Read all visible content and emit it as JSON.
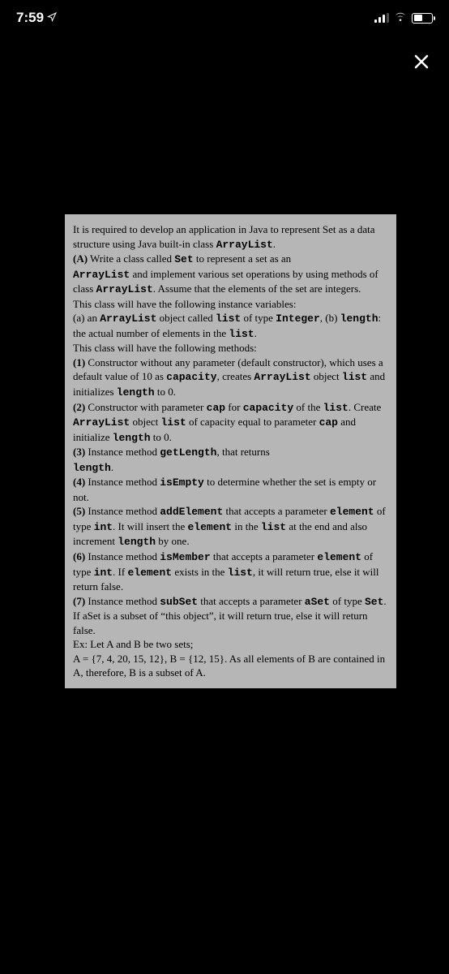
{
  "statusBar": {
    "time": "7:59"
  },
  "doc": {
    "intro1": "It is required to develop an application in Java to represent Set as a data structure using Java built-in class ",
    "intro_mono": "ArrayList",
    "intro_end": ".",
    "sectionA_prefix": "(A)",
    "sectionA_1": " Write a class called ",
    "sectionA_mono1": "Set",
    "sectionA_2": " to represent a set as an ",
    "sectionA_mono2": "ArrayList",
    "sectionA_3": " and implement various set operations by using methods of class ",
    "sectionA_mono3": "ArrayList",
    "sectionA_4": ". Assume that the elements of the set are integers.",
    "instVars": "This class will have the following instance variables:",
    "ivA_1": "(a) an ",
    "ivA_mono1": "ArrayList",
    "ivA_2": " object called ",
    "ivA_mono2": "list",
    "ivA_3": " of type ",
    "ivA_mono3": "Integer",
    "ivA_4": ", (b) ",
    "ivA_mono4": "length",
    "ivA_5": ": the actual number of elements in the ",
    "ivA_mono5": "list",
    "ivA_6": ".",
    "methodsIntro": "This class will have the following methods:",
    "m1_prefix": "(1)",
    "m1_1": " Constructor without any parameter (default constructor), which uses a default value of 10 as ",
    "m1_mono1": "capacity",
    "m1_2": ", creates ",
    "m1_mono2": "ArrayList",
    "m1_3": "  object ",
    "m1_mono3": "list",
    "m1_4": " and initializes ",
    "m1_mono4": "length",
    "m1_5": " to 0.",
    "m2_prefix": "(2)",
    "m2_1": " Constructor with parameter ",
    "m2_mono1": "cap",
    "m2_2": " for ",
    "m2_mono2": "capacity",
    "m2_3": " of the ",
    "m2_mono3": "list",
    "m2_4": ". Create ",
    "m2_mono4": "ArrayList",
    "m2_5": " object ",
    "m2_mono5": "list",
    "m2_6": " of capacity equal to parameter ",
    "m2_mono6": "cap",
    "m2_7": " and initialize ",
    "m2_mono7": "length",
    "m2_8": " to 0.",
    "m3_prefix": "(3)",
    "m3_1": " Instance method ",
    "m3_mono1": "getLength",
    "m3_2": ", that returns ",
    "m3_mono2": "length",
    "m3_3": ".",
    "m4_prefix": "(4)",
    "m4_1": " Instance method ",
    "m4_mono1": "isEmpty",
    "m4_2": " to determine whether the set is empty or not.",
    "m5_prefix": "(5)",
    "m5_1": " Instance method ",
    "m5_mono1": "addElement",
    "m5_2": " that accepts a parameter ",
    "m5_mono2": "element",
    "m5_3": " of type ",
    "m5_mono3": "int",
    "m5_4": ". It will insert the ",
    "m5_mono4": "element",
    "m5_5": " in the ",
    "m5_mono5": "list",
    "m5_6": " at the end and also increment ",
    "m5_mono6": "length",
    "m5_7": " by one.",
    "m6_prefix": "(6)",
    "m6_1": " Instance method ",
    "m6_mono1": "isMember",
    "m6_2": " that accepts a parameter ",
    "m6_mono2": "element",
    "m6_3": " of type ",
    "m6_mono3": "int",
    "m6_4": ". If ",
    "m6_mono4": "element",
    "m6_5": " exists in the ",
    "m6_mono5": "list",
    "m6_6": ", it will return true, else it will return false.",
    "m7_prefix": "(7)",
    "m7_1": " Instance method ",
    "m7_mono1": "subSet",
    "m7_2": "  that accepts a parameter ",
    "m7_mono2": "aSet",
    "m7_3": " of type ",
    "m7_mono3": "Set",
    "m7_4": ". If aSet is a subset of “this object”, it will return true, else it will return false.",
    "ex1": "Ex: Let A and B be two sets;",
    "ex2": "A = {7, 4, 20, 15, 12}, B = {12, 15}. As all elements of B are contained in A, therefore, B is a subset of A."
  }
}
